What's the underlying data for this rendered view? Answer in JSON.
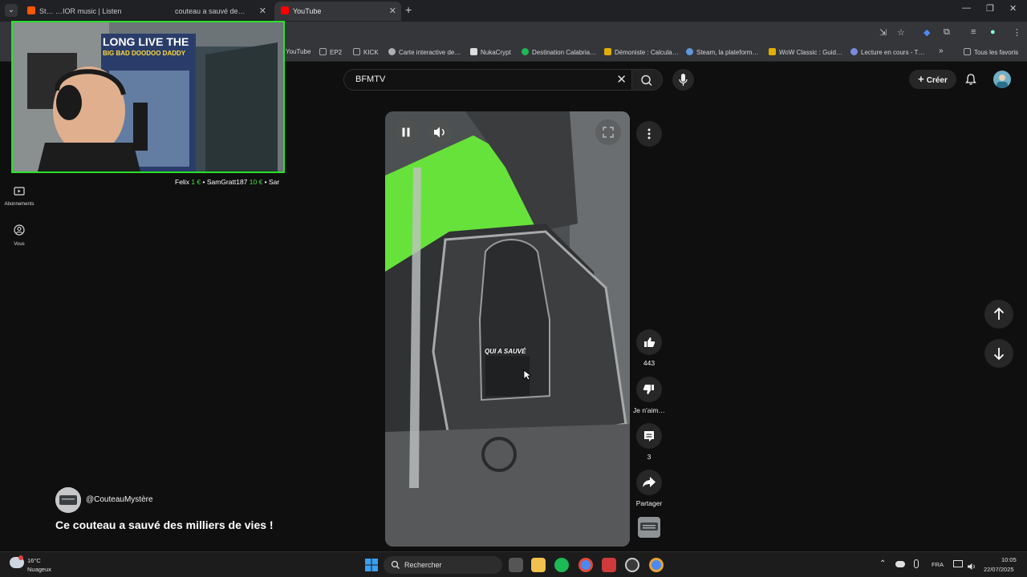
{
  "browser": {
    "tabs": [
      {
        "title": "St… …IOR music | Listen"
      },
      {
        "title": "couteau a sauvé de…"
      },
      {
        "title": "YouTube"
      }
    ],
    "new_tab": "+",
    "window_controls": {
      "minimize": "—",
      "restore": "❐",
      "close": "✕"
    }
  },
  "bookmarks": [
    {
      "label": "YouTube",
      "color": "#ff0000"
    },
    {
      "label": "EP2",
      "color": "#9aa0a6"
    },
    {
      "label": "KICK",
      "color": "#9aa0a6"
    },
    {
      "label": "Carte interactive de…",
      "color": "#b0b0b0"
    },
    {
      "label": "NukaCrypt",
      "color": "#dddddd"
    },
    {
      "label": "Destination Calabria…",
      "color": "#1db954"
    },
    {
      "label": "Démoniste : Calcula…",
      "color": "#e0b000"
    },
    {
      "label": "Steam, la plateform…",
      "color": "#5e98d9"
    },
    {
      "label": "WoW Classic : Guid…",
      "color": "#e0b000"
    },
    {
      "label": "Lecture en cours - T…",
      "color": "#7b8cde"
    }
  ],
  "bookmarks_more": "»",
  "bookmarks_all": "Tous les favoris",
  "youtube": {
    "search_query": "BFMTV",
    "create_label": "Créer",
    "sidebar": [
      {
        "label": "Abonnements"
      },
      {
        "label": "Vous"
      }
    ],
    "video": {
      "caption": "QUI A SAUVÉ",
      "likes": "443",
      "dislike_label": "Je n'aim…",
      "comments": "3",
      "share_label": "Partager",
      "channel": "@CouteauMystère",
      "title": "Ce couteau a sauvé des milliers de vies !"
    }
  },
  "stream_overlay": {
    "poster_line1": "LONG LIVE THE",
    "poster_line2": "BIG BAD DOODOO DADDY",
    "ticker": [
      {
        "name": "Felix ",
        "amount": "1 € ",
        "sep": "• "
      },
      {
        "name": "SamGratt187 ",
        "amount": "10 € ",
        "sep": "• "
      },
      {
        "name": "Sar",
        "amount": "",
        "sep": ""
      }
    ]
  },
  "taskbar": {
    "weather_temp": "16°C",
    "weather_desc": "Nuageux",
    "search_label": "Rechercher",
    "language": "FRA",
    "time": "10:05",
    "date": "22/07/2025"
  },
  "colors": {
    "accent_green": "#29e229",
    "youtube_red": "#ff0000",
    "bg": "#0f0f0f"
  }
}
